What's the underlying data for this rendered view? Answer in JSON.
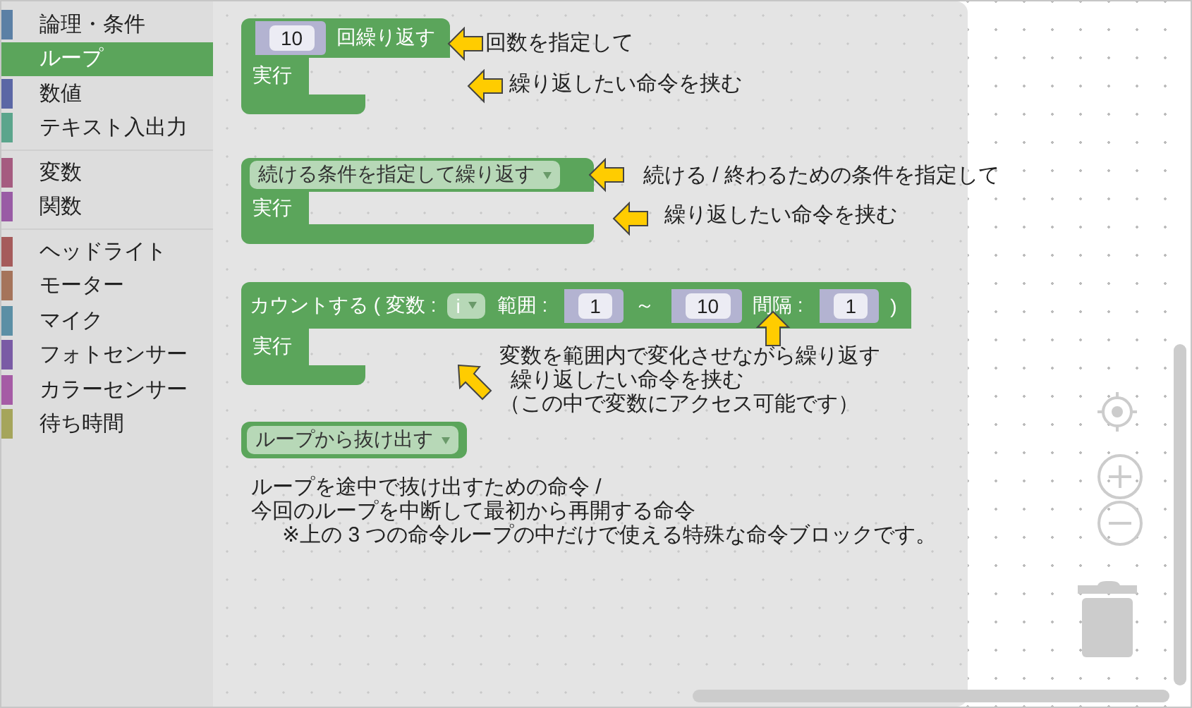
{
  "category_groups": [
    {
      "items": [
        {
          "label": "論理・条件",
          "color": "#5b80a5",
          "selected": false
        },
        {
          "label": "ループ",
          "color": "#5ba55b",
          "selected": true
        },
        {
          "label": "数値",
          "color": "#5b67a5",
          "selected": false
        },
        {
          "label": "テキスト入出力",
          "color": "#5ba58c",
          "selected": false
        }
      ]
    },
    {
      "items": [
        {
          "label": "変数",
          "color": "#a55b80",
          "selected": false
        },
        {
          "label": "関数",
          "color": "#995ba5",
          "selected": false
        }
      ]
    },
    {
      "items": [
        {
          "label": "ヘッドライト",
          "color": "#a55b5b",
          "selected": false
        },
        {
          "label": "モーター",
          "color": "#a5745b",
          "selected": false
        },
        {
          "label": "マイク",
          "color": "#5b8fa5",
          "selected": false
        },
        {
          "label": "フォトセンサー",
          "color": "#7a5ba5",
          "selected": false
        },
        {
          "label": "カラーセンサー",
          "color": "#a55ba5",
          "selected": false
        },
        {
          "label": "待ち時間",
          "color": "#a5a55b",
          "selected": false
        }
      ]
    }
  ],
  "blocks": [
    {
      "kind": "c-block",
      "header": [
        {
          "kind": "number",
          "text": "10"
        },
        {
          "kind": "label",
          "text": "回繰り返す"
        }
      ],
      "do_label": "実行"
    },
    {
      "kind": "c-block",
      "header": [
        {
          "kind": "dropdown",
          "text": "続ける条件を指定して繰り返す"
        }
      ],
      "do_label": "実行"
    },
    {
      "kind": "c-block",
      "header": [
        {
          "kind": "label",
          "text": "カウントする ( 変数 :"
        },
        {
          "kind": "variable",
          "text": "i"
        },
        {
          "kind": "label",
          "text": "範囲 :"
        },
        {
          "kind": "number",
          "text": "1"
        },
        {
          "kind": "label",
          "text": "～"
        },
        {
          "kind": "number",
          "text": "10"
        },
        {
          "kind": "label",
          "text": "間隔 :"
        },
        {
          "kind": "number",
          "text": "1"
        },
        {
          "kind": "label",
          "text": ")"
        }
      ],
      "do_label": "実行"
    },
    {
      "kind": "statement",
      "header": [
        {
          "kind": "dropdown",
          "text": "ループから抜け出す"
        }
      ]
    }
  ],
  "arrows": [
    {
      "kind": "left"
    },
    {
      "kind": "left"
    },
    {
      "kind": "left"
    },
    {
      "kind": "left"
    },
    {
      "kind": "up"
    },
    {
      "kind": "diagonal"
    }
  ],
  "notes": [
    {
      "lines": [
        {
          "text": "回数を指定して",
          "indented": false
        }
      ]
    },
    {
      "lines": [
        {
          "text": "繰り返したい命令を挟む",
          "indented": false
        }
      ]
    },
    {
      "lines": [
        {
          "text": "続ける / 終わるための条件を指定して",
          "indented": false
        }
      ]
    },
    {
      "lines": [
        {
          "text": "繰り返したい命令を挟む",
          "indented": false
        }
      ]
    },
    {
      "lines": [
        {
          "text": "変数を範囲内で変化させながら繰り返す",
          "indented": false
        },
        {
          "text": "繰り返したい命令を挟む",
          "indented": true
        },
        {
          "text": "（この中で変数にアクセス可能です）",
          "indented": false
        }
      ]
    },
    {
      "lines": [
        {
          "text": "ループを途中で抜け出すための命令 /",
          "indented": false
        },
        {
          "text": "今回のループを中断して最初から再開する命令",
          "indented": false
        },
        {
          "text": "※上の 3 つの命令ループの中だけで使える特殊な命令ブロックです。",
          "indented": true
        }
      ]
    }
  ]
}
